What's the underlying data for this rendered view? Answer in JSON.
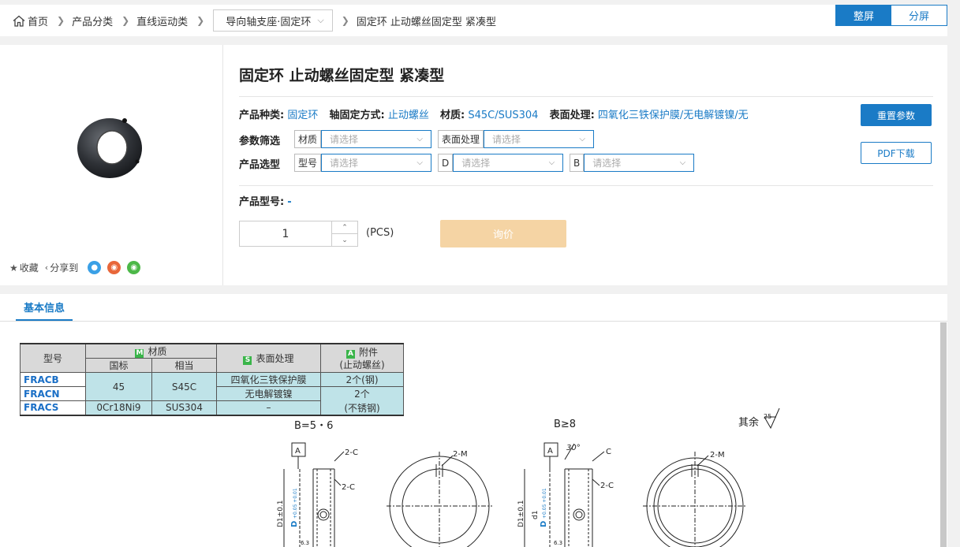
{
  "breadcrumb": {
    "home": "首页",
    "items": [
      "产品分类",
      "直线运动类"
    ],
    "dropdown": "导向轴支座·固定环",
    "current": "固定环 止动螺丝固定型 紧凑型"
  },
  "view_toggle": {
    "full": "整屏",
    "split": "分屏"
  },
  "product": {
    "title": "固定环 止动螺丝固定型 紧凑型",
    "specs": [
      {
        "label": "产品种类:",
        "value": "固定环"
      },
      {
        "label": "轴固定方式:",
        "value": "止动螺丝"
      },
      {
        "label": "材质:",
        "value": "S45C/SUS304"
      },
      {
        "label": "表面处理:",
        "value": "四氧化三铁保护膜/无电解镀镍/无"
      }
    ],
    "filter_label": "参数筛选",
    "select_label": "产品选型",
    "placeholder": "请选择",
    "filters": [
      {
        "label": "材质"
      },
      {
        "label": "表面处理"
      }
    ],
    "selects": [
      {
        "label": "型号"
      },
      {
        "label": "D"
      },
      {
        "label": "B"
      }
    ],
    "reset_button": "重置参数",
    "pdf_button": "PDF下载",
    "model_label": "产品型号:",
    "model_value": "-",
    "quantity": "1",
    "unit": "(PCS)",
    "inquiry_button": "询价"
  },
  "actions": {
    "favorite": "收藏",
    "share": "分享到"
  },
  "tab": "基本信息",
  "spec_table": {
    "headers": {
      "model": "型号",
      "material_tag": "M",
      "material": "材质",
      "national": "国标",
      "equivalent": "相当",
      "surface_tag": "S",
      "surface": "表面处理",
      "accessory_tag": "A",
      "accessory": "附件",
      "accessory_sub": "(止动螺丝)"
    },
    "rows": [
      {
        "code": "FRACB"
      },
      {
        "code": "FRACN"
      },
      {
        "code": "FRACS"
      }
    ],
    "material_45": "45",
    "material_s45c": "S45C",
    "material_0cr": "0Cr18Ni9",
    "material_sus": "SUS304",
    "surface_1": "四氧化三铁保护膜",
    "surface_2": "无电解镀镍",
    "surface_3": "–",
    "acc_1": "2个(钢)",
    "acc_2": "2个",
    "acc_3": "(不锈钢)"
  },
  "drawing": {
    "label_b56": "B=5・6",
    "label_b8": "B≥8",
    "label_rest": "其余",
    "rest_value": "25",
    "datum": "A",
    "chamfer_c": "2-C",
    "holes_m": "2-M",
    "angle": "30°",
    "c": "C",
    "dim_d1": "D1±0.1",
    "dim_d": "D",
    "dim_d_tol": "+0.05 +0.01",
    "dim_d1_small": "d1",
    "roughness": "6.3"
  }
}
